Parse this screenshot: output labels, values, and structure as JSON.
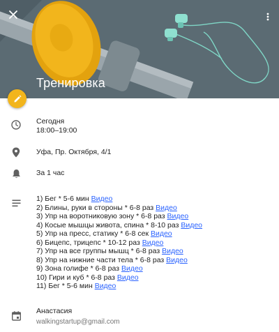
{
  "event": {
    "title": "Тренировка"
  },
  "header": {
    "close_icon": "close-icon",
    "more_icon": "more-vert-icon",
    "edit_icon": "pencil-icon",
    "accent_color": "#f2b51c",
    "banner_color": "#5b6b73"
  },
  "time": {
    "icon": "clock-icon",
    "day": "Сегодня",
    "range": "18:00–19:00"
  },
  "location": {
    "icon": "location-pin-icon",
    "address": "Уфа, Пр. Октября, 4/1"
  },
  "reminder": {
    "icon": "bell-icon",
    "text": "За 1 час"
  },
  "description": {
    "icon": "notes-icon",
    "link_color": "#2962ff",
    "items": [
      {
        "text": "1) Бег * 5-6 мин ",
        "link": "Видео"
      },
      {
        "text": "2) Блины, руки в стороны * 6-8 раз ",
        "link": "Видео"
      },
      {
        "text": "3) Упр на воротниковую зону * 6-8 раз ",
        "link": "Видео"
      },
      {
        "text": "4) Косые мышцы живота, спина * 8-10 раз ",
        "link": "Видео"
      },
      {
        "text": "5) Упр на пресс, статику * 6-8 сек ",
        "link": "Видео"
      },
      {
        "text": "6) Бицепс, трицепс * 10-12 раз ",
        "link": "Видео"
      },
      {
        "text": "7) Упр на все группы мышц * 6-8 раз ",
        "link": "Видео"
      },
      {
        "text": "8) Упр на нижние части тела * 6-8 раз ",
        "link": "Видео"
      },
      {
        "text": "9) Зона голифе * 6-8 раз ",
        "link": "Видео"
      },
      {
        "text": "10) Гири и куб * 6-8 раз ",
        "link": "Видео"
      },
      {
        "text": "11) Бег * 5-6 мин ",
        "link": "Видео"
      }
    ]
  },
  "calendar": {
    "icon": "calendar-icon",
    "owner": "Анастасия",
    "email": "walkingstartup@gmail.com"
  }
}
